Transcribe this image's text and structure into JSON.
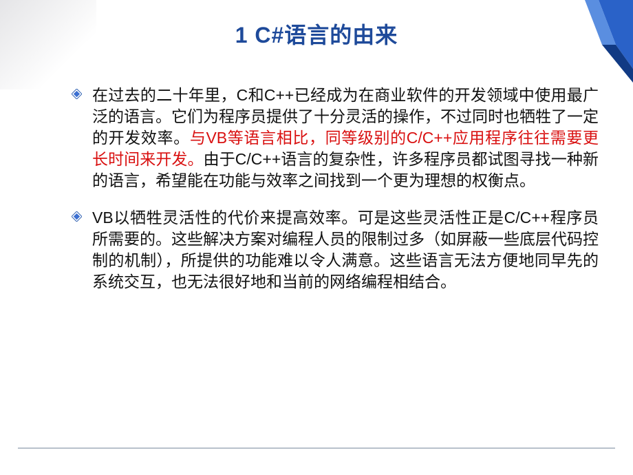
{
  "title": "1 C#语言的由来",
  "bullets": [
    {
      "parts": [
        {
          "text": "在过去的二十年里，C和C++已经成为在商业软件的开发领域中使用最广泛的语言。它们为程序员提供了十分灵活的操作，不过同时也牺牲了一定的开发效率。",
          "highlight": false
        },
        {
          "text": "与VB等语言相比，同等级别的C/C++应用程序往往需要更长时间来开发。",
          "highlight": true
        },
        {
          "text": "由于C/C++语言的复杂性，许多程序员都试图寻找一种新的语言，希望能在功能与效率之间找到一个更为理想的权衡点。",
          "highlight": false
        }
      ]
    },
    {
      "parts": [
        {
          "text": "VB以牺牲灵活性的代价来提高效率。可是这些灵活性正是C/C++程序员所需要的。这些解决方案对编程人员的限制过多（如屏蔽一些底层代码控制的机制），所提供的功能难以令人满意。这些语言无法方便地同早先的系统交互，也无法很好地和当前的网络编程相结合。",
          "highlight": false
        }
      ]
    }
  ]
}
